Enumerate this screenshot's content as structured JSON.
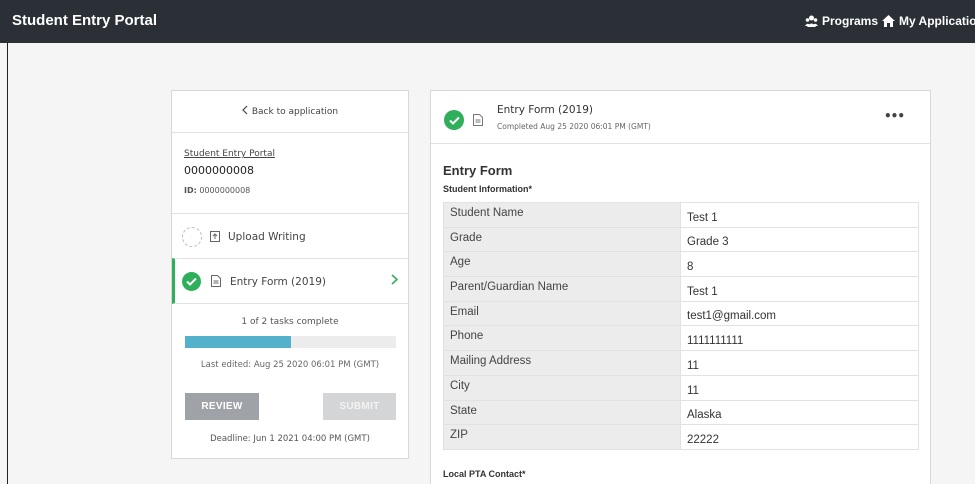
{
  "app": {
    "title": "Student Entry Portal"
  },
  "nav": {
    "programs_label": "Programs",
    "applications_label": "My Applications"
  },
  "sidebar": {
    "back_label": "Back to application",
    "portal_link": "Student Entry Portal",
    "application_number": "0000000008",
    "id_prefix": "ID:",
    "id_value": "0000000008",
    "tasks": [
      {
        "label": "Upload Writing",
        "status": "incomplete",
        "icon": "upload-icon"
      },
      {
        "label": "Entry Form (2019)",
        "status": "complete",
        "icon": "document-icon",
        "selected": true
      }
    ],
    "progress_text": "1 of 2 tasks complete",
    "progress_fraction": 0.5,
    "last_edited": "Last edited: Aug 25 2020 06:01 PM (GMT)",
    "review_label": "REVIEW",
    "submit_label": "SUBMIT",
    "deadline": "Deadline: Jun 1 2021 04:00 PM (GMT)"
  },
  "form": {
    "header_title": "Entry Form (2019)",
    "header_status": "Completed Aug 25 2020 06:01 PM (GMT)",
    "title": "Entry Form",
    "student_section": "Student Information*",
    "rows": [
      {
        "label": "Student Name",
        "value": "Test 1"
      },
      {
        "label": "Grade",
        "value": "Grade 3"
      },
      {
        "label": "Age",
        "value": "8"
      },
      {
        "label": "Parent/Guardian Name",
        "value": "Test 1"
      },
      {
        "label": "Email",
        "value": "test1@gmail.com"
      },
      {
        "label": "Phone",
        "value": "1111111111"
      },
      {
        "label": "Mailing Address",
        "value": "11"
      },
      {
        "label": "City",
        "value": "11"
      },
      {
        "label": "State",
        "value": "Alaska"
      },
      {
        "label": "ZIP",
        "value": "22222"
      }
    ],
    "pta_section": "Local PTA Contact*"
  },
  "colors": {
    "topbar": "#2b2f36",
    "success": "#2fae5c",
    "progress": "#54b1cc"
  }
}
